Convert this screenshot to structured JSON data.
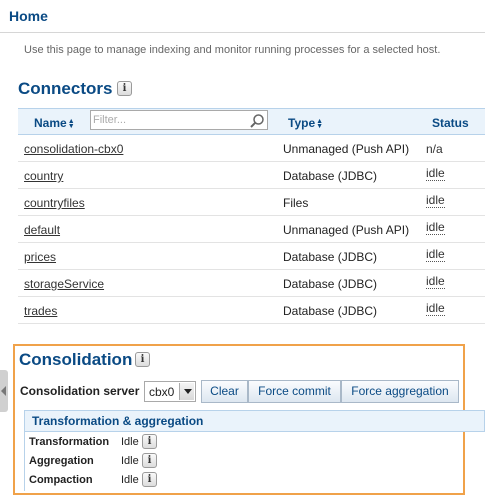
{
  "header": {
    "title": "Home"
  },
  "intro": "Use this page to manage indexing and monitor running processes for a selected host.",
  "connectors": {
    "title": "Connectors",
    "info_icon": "info-icon",
    "columns": {
      "name": "Name",
      "type": "Type",
      "status": "Status"
    },
    "filter_placeholder": "Filter...",
    "rows": [
      {
        "name": "consolidation-cbx0",
        "type": "Unmanaged (Push API)",
        "status": "n/a"
      },
      {
        "name": "country",
        "type": "Database (JDBC)",
        "status": "idle"
      },
      {
        "name": "countryfiles",
        "type": "Files",
        "status": "idle"
      },
      {
        "name": "default",
        "type": "Unmanaged (Push API)",
        "status": "idle"
      },
      {
        "name": "prices",
        "type": "Database (JDBC)",
        "status": "idle"
      },
      {
        "name": "storageService",
        "type": "Database (JDBC)",
        "status": "idle"
      },
      {
        "name": "trades",
        "type": "Database (JDBC)",
        "status": "idle"
      }
    ]
  },
  "consolidation": {
    "title": "Consolidation",
    "server_label": "Consolidation server",
    "server_value": "cbx0",
    "buttons": {
      "clear": "Clear",
      "force_commit": "Force commit",
      "force_aggregation": "Force aggregation"
    },
    "panel_title": "Transformation & aggregation",
    "processes": [
      {
        "label": "Transformation",
        "status": "Idle"
      },
      {
        "label": "Aggregation",
        "status": "Idle"
      },
      {
        "label": "Compaction",
        "status": "Idle"
      }
    ]
  },
  "colors": {
    "accent": "#0a4a84",
    "highlight_border": "#f0a24a",
    "header_bg": "#eaf3fb"
  }
}
